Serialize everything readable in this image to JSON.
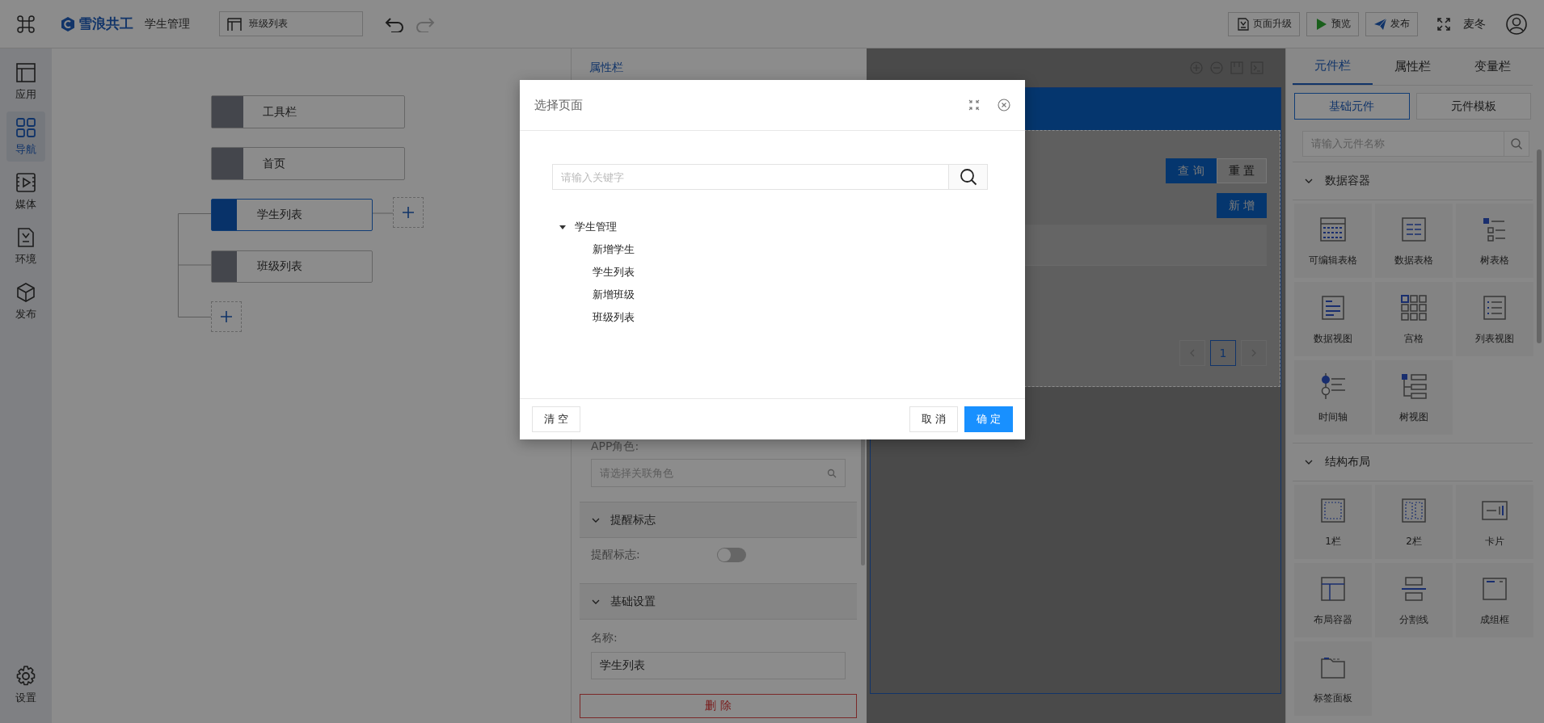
{
  "top_bar": {
    "brand": "雪浪共工",
    "app_name": "学生管理",
    "current_page": "班级列表",
    "actions": [
      {
        "label": "页面升级",
        "kind": "upgrade"
      },
      {
        "label": "预览",
        "kind": "preview"
      },
      {
        "label": "发布",
        "kind": "publish"
      }
    ],
    "user": "麦冬"
  },
  "left_rail": {
    "items": [
      {
        "label": "应用",
        "kind": "app",
        "selected": false
      },
      {
        "label": "导航",
        "kind": "nav",
        "selected": true
      },
      {
        "label": "媒体",
        "kind": "media",
        "selected": false
      },
      {
        "label": "环境",
        "kind": "env",
        "selected": false
      },
      {
        "label": "发布",
        "kind": "publish",
        "selected": false
      }
    ],
    "settings": {
      "label": "设置"
    }
  },
  "nav_tree": {
    "top_nodes": [
      {
        "label": "工具栏",
        "selected": false
      },
      {
        "label": "首页",
        "selected": false
      }
    ],
    "menu_nodes": [
      {
        "label": "学生列表",
        "selected": true
      },
      {
        "label": "班级列表",
        "selected": false
      }
    ]
  },
  "properties_panel": {
    "tabs": [
      {
        "label": "属性栏",
        "selected": true
      }
    ],
    "role_label": "APP角色:",
    "role_placeholder": "请选择关联角色",
    "reminder_section": {
      "title": "提醒标志",
      "expanded": true,
      "field_label": "提醒标志:",
      "on": false
    },
    "basic_section": {
      "title": "基础设置",
      "expanded": true,
      "name_label": "名称:",
      "name_value": "学生列表"
    },
    "delete_button": "删 除"
  },
  "canvas": {
    "query_button": "查 询",
    "reset_button": "重 置",
    "add_button": "新 增",
    "pages": [
      {
        "label": "1",
        "selected": true
      }
    ]
  },
  "component_panel": {
    "tabs": [
      {
        "label": "元件栏",
        "selected": true
      },
      {
        "label": "属性栏",
        "selected": false
      },
      {
        "label": "变量栏",
        "selected": false
      }
    ],
    "sub_tabs": [
      {
        "label": "基础元件",
        "selected": true
      },
      {
        "label": "元件模板",
        "selected": false
      }
    ],
    "search_placeholder": "请输入元件名称",
    "groups": [
      {
        "title": "数据容器",
        "expanded": true,
        "items": [
          {
            "label": "可编辑表格",
            "kind": "editable_table"
          },
          {
            "label": "数据表格",
            "kind": "data_table"
          },
          {
            "label": "树表格",
            "kind": "tree_table"
          },
          {
            "label": "数据视图",
            "kind": "data_view"
          },
          {
            "label": "宫格",
            "kind": "grid"
          },
          {
            "label": "列表视图",
            "kind": "list_view"
          },
          {
            "label": "时间轴",
            "kind": "timeline"
          },
          {
            "label": "树视图",
            "kind": "tree_view"
          }
        ]
      },
      {
        "title": "结构布局",
        "expanded": true,
        "items": [
          {
            "label": "1栏",
            "kind": "column_1"
          },
          {
            "label": "2栏",
            "kind": "column_2"
          },
          {
            "label": "卡片",
            "kind": "card"
          },
          {
            "label": "布局容器",
            "kind": "layout"
          },
          {
            "label": "分割线",
            "kind": "divider"
          },
          {
            "label": "成组框",
            "kind": "group_box"
          },
          {
            "label": "标签面板",
            "kind": "tab_panel"
          }
        ]
      }
    ]
  },
  "dialog": {
    "title": "选择页面",
    "search_placeholder": "请输入关键字",
    "tree": [
      {
        "label": "学生管理",
        "expanded": true,
        "children": [
          {
            "label": "新增学生"
          },
          {
            "label": "学生列表"
          },
          {
            "label": "新增班级"
          },
          {
            "label": "班级列表"
          }
        ]
      }
    ],
    "clear_button": "清 空",
    "cancel_button": "取 消",
    "ok_button": "确 定"
  }
}
